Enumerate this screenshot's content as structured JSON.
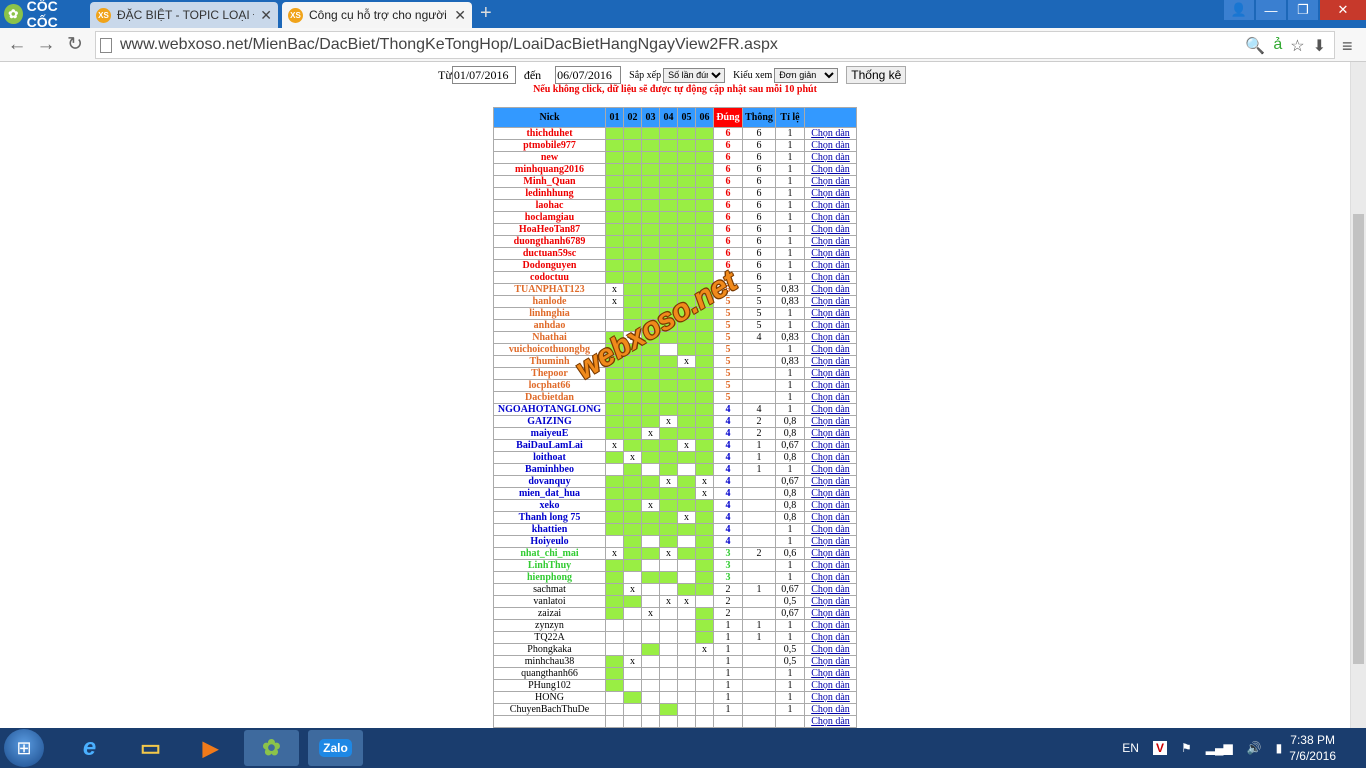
{
  "browser": {
    "logo": "CỐC CỐC",
    "tabs": [
      {
        "label": "ĐẶC BIỆT - TOPIC LOẠI ĐẶ",
        "icon": "xs-favicon"
      },
      {
        "label": "Công cụ hỗ trợ cho người",
        "icon": "xs-favicon"
      }
    ],
    "url": "www.webxoso.net/MienBac/DacBiet/ThongKeTongHop/LoaiDacBietHangNgayView2FR.aspx"
  },
  "form": {
    "from_label": "Từ",
    "from_value": "01/07/2016",
    "to_label": "đến",
    "to_value": "06/07/2016",
    "sort_label": "Sắp xếp",
    "sort_value": "Số lần đúng",
    "view_label": "Kiểu xem",
    "view_value": "Đơn giản",
    "submit": "Thống kê"
  },
  "notice": "Nếu không click, dữ liệu sẽ được tự động cập nhật sau mỗi 10 phút",
  "table": {
    "headers": [
      "Nick",
      "01",
      "02",
      "03",
      "04",
      "05",
      "06",
      "Đúng",
      "Thông",
      "Tỉ lệ",
      ""
    ],
    "colors": {
      "6": "#e00",
      "5": "#e06b2a",
      "4": "#00c",
      "3": "#33cc33",
      "other": "#000",
      "green_cell": "#99ee44",
      "header": "#3399ff"
    },
    "rows": [
      {
        "nick": "thichduhet",
        "days": "gggggg",
        "dung": "6",
        "thong": "6",
        "tile": "1",
        "link": "Chọn dàn"
      },
      {
        "nick": "ptmobile977",
        "days": "gggggg",
        "dung": "6",
        "thong": "6",
        "tile": "1",
        "link": "Chọn dàn"
      },
      {
        "nick": "new",
        "days": "gggggg",
        "dung": "6",
        "thong": "6",
        "tile": "1",
        "link": "Chọn dàn"
      },
      {
        "nick": "minhquang2016",
        "days": "gggggg",
        "dung": "6",
        "thong": "6",
        "tile": "1",
        "link": "Chọn dàn"
      },
      {
        "nick": "Minh_Quan",
        "days": "gggggg",
        "dung": "6",
        "thong": "6",
        "tile": "1",
        "link": "Chọn dàn"
      },
      {
        "nick": "ledinhhung",
        "days": "gggggg",
        "dung": "6",
        "thong": "6",
        "tile": "1",
        "link": "Chọn dàn"
      },
      {
        "nick": "laohac",
        "days": "gggggg",
        "dung": "6",
        "thong": "6",
        "tile": "1",
        "link": "Chọn dàn"
      },
      {
        "nick": "hoclamgiau",
        "days": "gggggg",
        "dung": "6",
        "thong": "6",
        "tile": "1",
        "link": "Chọn dàn"
      },
      {
        "nick": "HoaHeoTan87",
        "days": "gggggg",
        "dung": "6",
        "thong": "6",
        "tile": "1",
        "link": "Chọn dàn"
      },
      {
        "nick": "duongthanh6789",
        "days": "gggggg",
        "dung": "6",
        "thong": "6",
        "tile": "1",
        "link": "Chọn dàn"
      },
      {
        "nick": "ductuan59sc",
        "days": "gggggg",
        "dung": "6",
        "thong": "6",
        "tile": "1",
        "link": "Chọn dàn"
      },
      {
        "nick": "Dodonguyen",
        "days": "gggggg",
        "dung": "6",
        "thong": "6",
        "tile": "1",
        "link": "Chọn dàn"
      },
      {
        "nick": "codoctuu",
        "days": "gggggg",
        "dung": "6",
        "thong": "6",
        "tile": "1",
        "link": "Chọn dàn"
      },
      {
        "nick": "TUANPHAT123",
        "days": "xggggg",
        "dung": "5",
        "thong": "5",
        "tile": "0,83",
        "link": "Chọn dàn"
      },
      {
        "nick": "hanlode",
        "days": "xggggg",
        "dung": "5",
        "thong": "5",
        "tile": "0,83",
        "link": "Chọn dàn"
      },
      {
        "nick": "linhnghia",
        "days": "-ggggg",
        "dung": "5",
        "thong": "5",
        "tile": "1",
        "link": "Chọn dàn"
      },
      {
        "nick": "anhdao",
        "days": "-ggggg",
        "dung": "5",
        "thong": "5",
        "tile": "1",
        "link": "Chọn dàn"
      },
      {
        "nick": "Nhathai",
        "days": "gxgggg",
        "dung": "5",
        "thong": "4",
        "tile": "0,83",
        "link": "Chọn dàn"
      },
      {
        "nick": "vuichoicothuongbg",
        "days": "ggg-gg",
        "dung": "5",
        "thong": "",
        "tile": "1",
        "link": "Chọn dàn"
      },
      {
        "nick": "Thuminh",
        "days": "ggggxg",
        "dung": "5",
        "thong": "",
        "tile": "0,83",
        "link": "Chọn dàn"
      },
      {
        "nick": "Thepoor",
        "days": "gggggg",
        "dung": "5",
        "thong": "",
        "tile": "1",
        "link": "Chọn dàn"
      },
      {
        "nick": "locphat66",
        "days": "gggggg",
        "dung": "5",
        "thong": "",
        "tile": "1",
        "link": "Chọn dàn"
      },
      {
        "nick": "Dacbietdan",
        "days": "gggggg",
        "dung": "5",
        "thong": "",
        "tile": "1",
        "link": "Chọn dàn"
      },
      {
        "nick": "NGOAHOTANGLONG",
        "days": "gggggg",
        "dung": "4",
        "thong": "4",
        "tile": "1",
        "link": "Chọn dàn"
      },
      {
        "nick": "GAIZING",
        "days": "gggxgg",
        "dung": "4",
        "thong": "2",
        "tile": "0,8",
        "link": "Chọn dàn"
      },
      {
        "nick": "maiyeuE",
        "days": "ggxggg",
        "dung": "4",
        "thong": "2",
        "tile": "0,8",
        "link": "Chọn dàn"
      },
      {
        "nick": "BaiDauLamLai",
        "days": "xgggxg",
        "dung": "4",
        "thong": "1",
        "tile": "0,67",
        "link": "Chọn dàn"
      },
      {
        "nick": "loithoat",
        "days": "gxgggg",
        "dung": "4",
        "thong": "1",
        "tile": "0,8",
        "link": "Chọn dàn"
      },
      {
        "nick": "Baminhbeo",
        "days": "-g-g-g",
        "dung": "4",
        "thong": "1",
        "tile": "1",
        "link": "Chọn dàn"
      },
      {
        "nick": "dovanquy",
        "days": "gggxgx",
        "dung": "4",
        "thong": "",
        "tile": "0,67",
        "link": "Chọn dàn"
      },
      {
        "nick": "mien_dat_hua",
        "days": "gggggx",
        "dung": "4",
        "thong": "",
        "tile": "0,8",
        "link": "Chọn dàn"
      },
      {
        "nick": "xeko",
        "days": "ggxggg",
        "dung": "4",
        "thong": "",
        "tile": "0,8",
        "link": "Chọn dàn"
      },
      {
        "nick": "Thanh long 75",
        "days": "ggggxg",
        "dung": "4",
        "thong": "",
        "tile": "0,8",
        "link": "Chọn dàn"
      },
      {
        "nick": "khattien",
        "days": "gggggg",
        "dung": "4",
        "thong": "",
        "tile": "1",
        "link": "Chọn dàn"
      },
      {
        "nick": "Hoiyeulo",
        "days": "-g-g-g",
        "dung": "4",
        "thong": "",
        "tile": "1",
        "link": "Chọn dàn"
      },
      {
        "nick": "nhat_chi_mai",
        "days": "xggxgg",
        "dung": "3",
        "thong": "2",
        "tile": "0,6",
        "link": "Chọn dàn"
      },
      {
        "nick": "LinhThuy",
        "days": "gg---g",
        "dung": "3",
        "thong": "",
        "tile": "1",
        "link": "Chọn dàn"
      },
      {
        "nick": "hienphong",
        "days": "g-gg-g",
        "dung": "3",
        "thong": "",
        "tile": "1",
        "link": "Chọn dàn"
      },
      {
        "nick": "sachmat",
        "days": "gx--gg",
        "dung": "2",
        "thong": "1",
        "tile": "0,67",
        "link": "Chọn dàn"
      },
      {
        "nick": "vanlatoi",
        "days": "gg-xx-",
        "dung": "2",
        "thong": "",
        "tile": "0,5",
        "link": "Chọn dàn"
      },
      {
        "nick": "zaizai",
        "days": "g-x--g",
        "dung": "2",
        "thong": "",
        "tile": "0,67",
        "link": "Chọn dàn"
      },
      {
        "nick": "zynzyn",
        "days": "-----g",
        "dung": "1",
        "thong": "1",
        "tile": "1",
        "link": "Chọn dàn"
      },
      {
        "nick": "TQ22A",
        "days": "-----g",
        "dung": "1",
        "thong": "1",
        "tile": "1",
        "link": "Chọn dàn"
      },
      {
        "nick": "Phongkaka",
        "days": "--g--x",
        "dung": "1",
        "thong": "",
        "tile": "0,5",
        "link": "Chọn dàn"
      },
      {
        "nick": "minhchau38",
        "days": "gx----",
        "dung": "1",
        "thong": "",
        "tile": "0,5",
        "link": "Chọn dàn"
      },
      {
        "nick": "quangthanh66",
        "days": "g-----",
        "dung": "1",
        "thong": "",
        "tile": "1",
        "link": "Chọn dàn"
      },
      {
        "nick": "PHung102",
        "days": "g-----",
        "dung": "1",
        "thong": "",
        "tile": "1",
        "link": "Chọn dàn"
      },
      {
        "nick": "HONG",
        "days": "-g----",
        "dung": "1",
        "thong": "",
        "tile": "1",
        "link": "Chọn dàn"
      },
      {
        "nick": "ChuyenBachThuDe",
        "days": "---g--",
        "dung": "1",
        "thong": "",
        "tile": "1",
        "link": "Chọn dàn"
      },
      {
        "nick": "",
        "days": "------",
        "dung": "",
        "thong": "",
        "tile": "",
        "link": "Chọn dàn"
      }
    ]
  },
  "watermark": "webxoso.net",
  "taskbar": {
    "apps": [
      "ie-icon",
      "explorer-icon",
      "media-icon",
      "coccoc-icon",
      "zalo-icon"
    ],
    "zalo": "Zalo",
    "lang": "EN",
    "time": "7:38 PM",
    "date": "7/6/2016"
  }
}
